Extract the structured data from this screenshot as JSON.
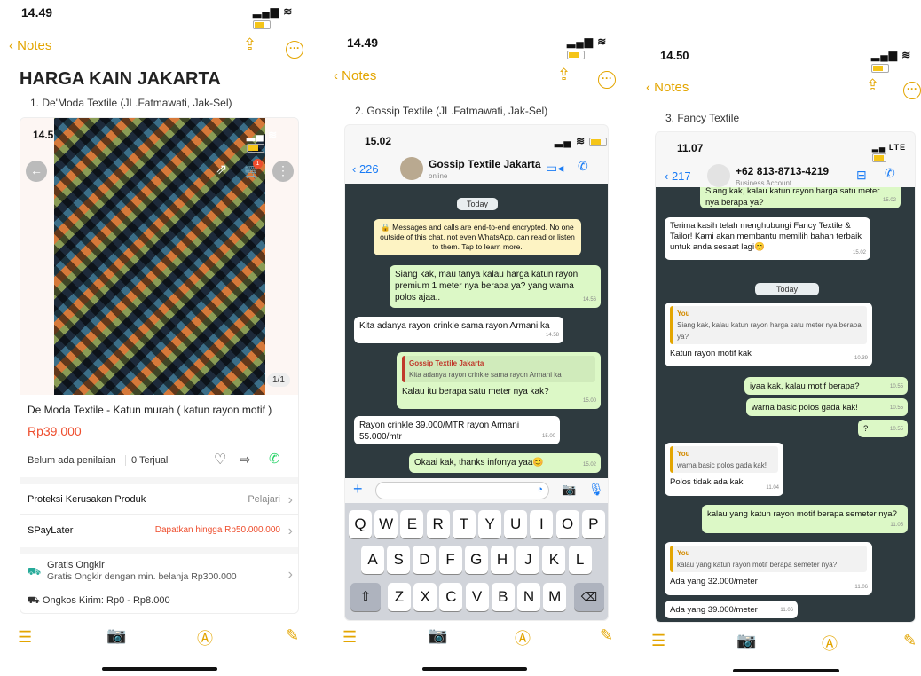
{
  "p1": {
    "time": "14.49",
    "back": "Notes",
    "title": "HARGA KAIN JAKARTA",
    "caption": "1. De'Moda Textile (JL.Fatmawati, Jak-Sel)",
    "inner_time": "14.5",
    "img_counter": "1/1",
    "badge": "1",
    "product": "De Moda Textile - Katun murah ( katun rayon motif )",
    "price": "Rp39.000",
    "rating": "Belum ada penilaian",
    "sold": "0 Terjual",
    "protection": "Proteksi Kerusakan Produk",
    "protection_link": "Pelajari",
    "spay": "SPayLater",
    "spay_offer": "Dapatkan hingga Rp50.000.000",
    "ship_title": "Gratis Ongkir",
    "ship_sub": "Gratis Ongkir dengan min. belanja Rp300.000",
    "ongkos": "Ongkos Kirim: Rp0 - Rp8.000"
  },
  "p2": {
    "time": "14.49",
    "back": "Notes",
    "caption": "2. Gossip Textile (JL.Fatmawati, Jak-Sel)",
    "inner_time": "15.02",
    "back_count": "226",
    "contact": "Gossip Textile Jakarta",
    "status": "online",
    "today": "Today",
    "e2e": "Messages and calls are end-to-end encrypted. No one outside of this chat, not even WhatsApp, can read or listen to them. Tap to learn more.",
    "m1": "Siang kak, mau tanya kalau harga katun rayon premium 1 meter nya berapa ya? yang warna polos ajaa..",
    "m1t": "14.56",
    "m2": "Kita adanya rayon crinkle sama rayon Armani ka",
    "m2t": "14.58",
    "q_name": "Gossip Textile Jakarta",
    "q_text": "Kita adanya rayon crinkle sama rayon Armani ka",
    "m3": "Kalau itu berapa satu meter nya kak?",
    "m3t": "15.00",
    "m4": "Rayon crinkle 39.000/MTR rayon Armani 55.000/mtr",
    "m4t": "15.00",
    "m5": "Okaai kak, thanks infonya yaa😊",
    "m5t": "15.02",
    "row1": [
      "Q",
      "W",
      "E",
      "R",
      "T",
      "Y",
      "U",
      "I",
      "O",
      "P"
    ],
    "row2": [
      "A",
      "S",
      "D",
      "F",
      "G",
      "H",
      "J",
      "K",
      "L"
    ],
    "row3": [
      "Z",
      "X",
      "C",
      "V",
      "B",
      "N",
      "M"
    ]
  },
  "p3": {
    "time": "14.50",
    "back": "Notes",
    "caption": "3. Fancy Textile",
    "inner_time": "11.07",
    "lte": "LTE",
    "back_count": "217",
    "contact": "+62 813-8713-4219",
    "status": "Business Account",
    "top": "Siang kak, kalau katun rayon harga satu meter nya berapa ya?",
    "topt": "15.02",
    "auto": "Terima kasih telah menghubungi Fancy Textile & Tailor! Kami akan membantu memilih bahan terbaik untuk anda sesaat lagi😊",
    "autot": "15.02",
    "today": "Today",
    "you": "You",
    "q1": "Siang kak, kalau katun rayon harga satu meter nya berapa ya?",
    "r1": "Katun rayon motif kak",
    "r1t": "10.39",
    "m1": "iyaa kak, kalau motif berapa?",
    "m1t": "10.55",
    "m2": "warna basic polos gada kak!",
    "m2t": "10.55",
    "m3": "?",
    "m3t": "10.55",
    "q2": "warna basic polos gada kak!",
    "r2": "Polos tidak ada kak",
    "r2t": "11.04",
    "m4": "kalau yang katun rayon motif berapa semeter nya?",
    "m4t": "11.05",
    "q3": "kalau yang katun rayon motif berapa semeter nya?",
    "r3": "Ada yang 32.000/meter",
    "r3t": "11.06",
    "r4": "Ada yang 39.000/meter",
    "r4t": "11.06"
  }
}
